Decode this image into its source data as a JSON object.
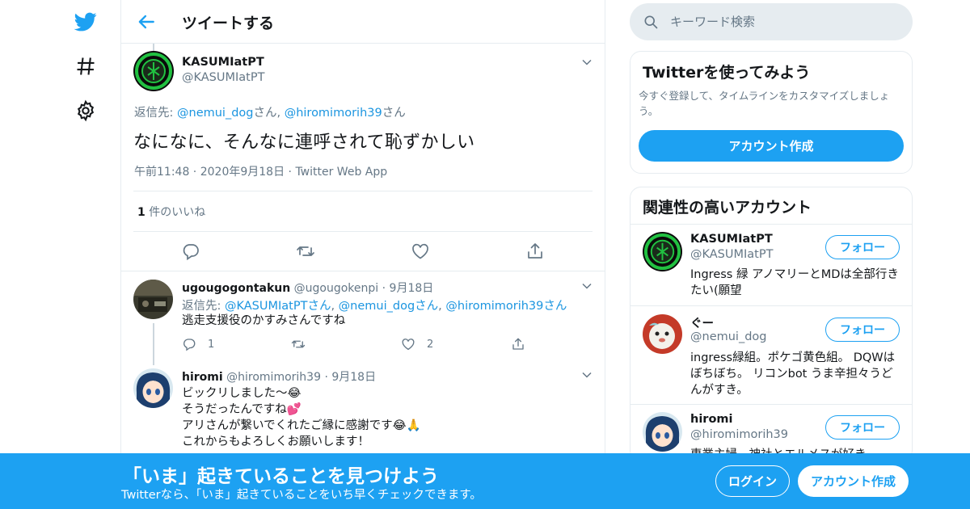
{
  "colors": {
    "accent": "#1da1f2",
    "link": "#1b95e0",
    "muted": "#657786",
    "border": "#e6ecf0"
  },
  "nav": {
    "icons": [
      "twitter-bird-icon",
      "hashtag-icon",
      "gear-icon"
    ]
  },
  "header": {
    "title": "ツイートする"
  },
  "main_tweet": {
    "name": "KASUMIatPT",
    "handle": "@KASUMIatPT",
    "reply_prefix": "返信先: ",
    "reply_user1": "@nemui_dog",
    "reply_san1": "さん, ",
    "reply_user2": "@hiromimorih39",
    "reply_san2": "さん",
    "text": "なになに、そんなに連呼されて恥ずかしい",
    "time": "午前11:48",
    "date": "2020年9月18日",
    "source": "Twitter Web App",
    "likes_count": "1",
    "likes_label": " 件のいいね"
  },
  "replies": [
    {
      "name": "ugougogontakun",
      "handle": "@ugougokenpi",
      "date": "9月18日",
      "reply_prefix": "返信先: ",
      "mentions": [
        "@KASUMIatPTさん",
        "@nemui_dogさん",
        "@hiromimorih39さん"
      ],
      "text": "逃走支援役のかすみさんですね",
      "reply_count": "1",
      "like_count": "2"
    },
    {
      "name": "hiromi",
      "handle": "@hiromimorih39",
      "date": "9月18日",
      "lines": [
        "ビックリしました～😂",
        "そうだったんですね💕",
        "アリさんが繋いでくれたご縁に感謝です😂🙏",
        "これからもよろしくお願いします！"
      ]
    }
  ],
  "search": {
    "placeholder": "キーワード検索"
  },
  "signup_card": {
    "title": "Twitterを使ってみよう",
    "desc": "今すぐ登録して、タイムラインをカスタマイズしましょう。",
    "button": "アカウント作成"
  },
  "related_card": {
    "title": "関連性の高いアカウント",
    "follow_label": "フォロー",
    "accounts": [
      {
        "name": "KASUMIatPT",
        "handle": "@KASUMIatPT",
        "bio": "Ingress 緑 アノマリーとMDは全部行きたい(願望"
      },
      {
        "name": "ぐー",
        "handle": "@nemui_dog",
        "bio": "ingress緑組。ポケゴ黄色組。 DQWはぼちぼち。 リコンbot うま辛担々うどんがすき。"
      },
      {
        "name": "hiromi",
        "handle": "@hiromimorih39",
        "bio": "専業主婦。神社とエルメスが好き。"
      }
    ]
  },
  "banner": {
    "title": "「いま」起きていることを見つけよう",
    "subtitle": "Twitterなら、「いま」起きていることをいち早くチェックできます。",
    "login": "ログイン",
    "signup": "アカウント作成"
  }
}
